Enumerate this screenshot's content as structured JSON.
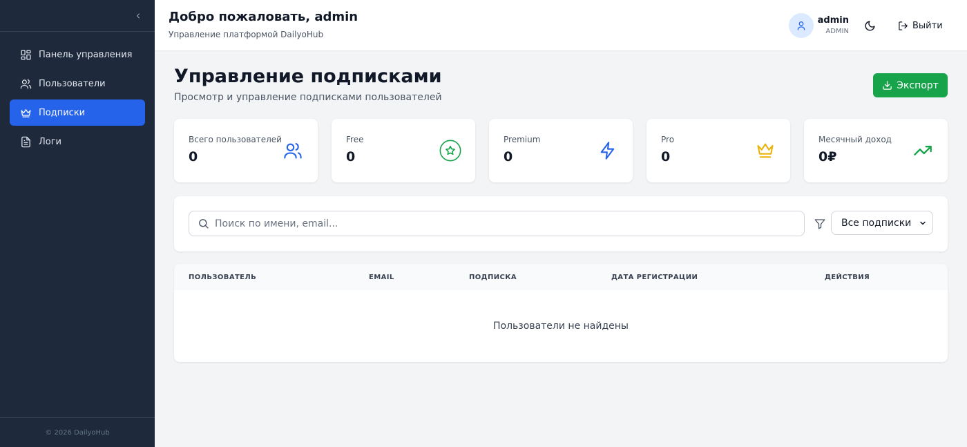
{
  "sidebar": {
    "items": [
      {
        "label": "Панель управления",
        "icon": "dashboard-icon",
        "active": false
      },
      {
        "label": "Пользователи",
        "icon": "users-icon",
        "active": false
      },
      {
        "label": "Подписки",
        "icon": "crown-icon",
        "active": true
      },
      {
        "label": "Логи",
        "icon": "file-text-icon",
        "active": false
      }
    ],
    "footer": "© 2026 DailyoHub"
  },
  "header": {
    "title": "Добро пожаловать, admin",
    "subtitle": "Управление платформой DailyoHub",
    "user_name": "admin",
    "user_role": "ADMIN",
    "logout_label": "Выйти"
  },
  "page": {
    "title": "Управление подписками",
    "subtitle": "Просмотр и управление подписками пользователей",
    "export_label": "Экспорт"
  },
  "stats": [
    {
      "label": "Всего пользователей",
      "value": "0",
      "icon": "users-icon",
      "color": "#2563eb"
    },
    {
      "label": "Free",
      "value": "0",
      "icon": "star-circle-icon",
      "color": "#16a34a"
    },
    {
      "label": "Premium",
      "value": "0",
      "icon": "zap-icon",
      "color": "#2563eb"
    },
    {
      "label": "Pro",
      "value": "0",
      "icon": "crown-icon",
      "color": "#eab308"
    },
    {
      "label": "Месячный доход",
      "value": "0₽",
      "icon": "trending-up-icon",
      "color": "#16a34a"
    }
  ],
  "filters": {
    "search_placeholder": "Поиск по имени, email...",
    "select_value": "Все подписки"
  },
  "table": {
    "columns": [
      "ПОЛЬЗОВАТЕЛЬ",
      "EMAIL",
      "ПОДПИСКА",
      "ДАТА РЕГИСТРАЦИИ",
      "ДЕЙСТВИЯ"
    ],
    "empty_text": "Пользователи не найдены"
  },
  "colors": {
    "sidebar_bg": "#1e293b",
    "accent": "#2563eb",
    "export_green": "#16a34a"
  }
}
